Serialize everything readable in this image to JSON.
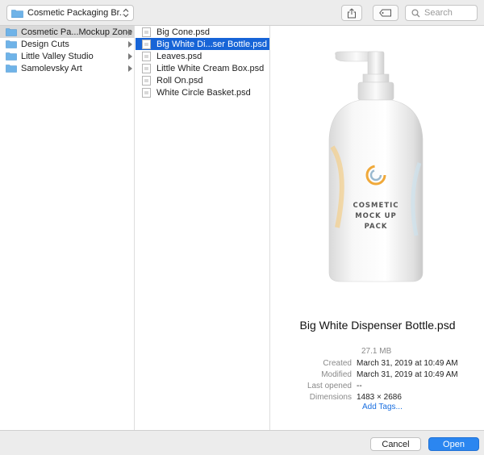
{
  "toolbar": {
    "path_popup_label": "Cosmetic Packaging Br...",
    "search_placeholder": "Search"
  },
  "columns": {
    "col1": [
      {
        "label": "Cosmetic Pa...Mockup Zone",
        "selected": true,
        "has_children": true
      },
      {
        "label": "Design Cuts",
        "selected": false,
        "has_children": true
      },
      {
        "label": "Little Valley Studio",
        "selected": false,
        "has_children": true
      },
      {
        "label": "Samolevsky Art",
        "selected": false,
        "has_children": true
      }
    ],
    "col2": [
      {
        "label": "Big Cone.psd",
        "selected": false
      },
      {
        "label": "Big White Di...ser Bottle.psd",
        "selected": true
      },
      {
        "label": "Leaves.psd",
        "selected": false
      },
      {
        "label": "Little White Cream Box.psd",
        "selected": false
      },
      {
        "label": "Roll On.psd",
        "selected": false
      },
      {
        "label": "White Circle Basket.psd",
        "selected": false
      }
    ]
  },
  "preview": {
    "bottle_label_lines": [
      "COSMETIC",
      "MOCK UP",
      "PACK"
    ],
    "file_name": "Big White Dispenser Bottle.psd",
    "size": "27.1 MB",
    "meta": [
      {
        "key": "Created",
        "value": "March 31, 2019 at 10:49 AM"
      },
      {
        "key": "Modified",
        "value": "March 31, 2019 at 10:49 AM"
      },
      {
        "key": "Last opened",
        "value": "--"
      },
      {
        "key": "Dimensions",
        "value": "1483 × 2686"
      }
    ],
    "add_tags": "Add Tags..."
  },
  "footer": {
    "cancel_label": "Cancel",
    "open_label": "Open"
  },
  "colors": {
    "selection_blue": "#1764d7",
    "accent_button": "#2b86f0",
    "link_blue": "#1a6fe0",
    "folder_blue": "#6fb3e8"
  },
  "icons": [
    "folder-icon",
    "chevron-updown-icon",
    "share-icon",
    "tag-icon",
    "search-icon",
    "psd-file-icon",
    "disclosure-arrow-icon"
  ]
}
